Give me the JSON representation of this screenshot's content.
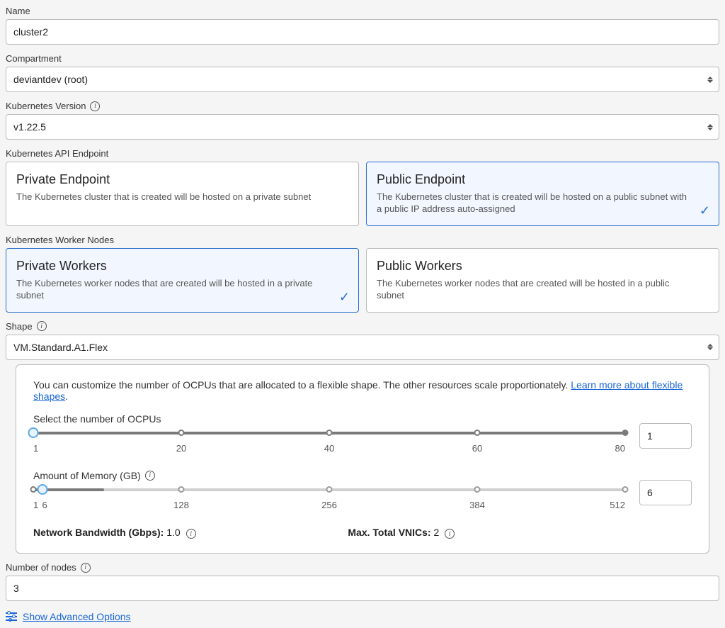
{
  "name": {
    "label": "Name",
    "value": "cluster2"
  },
  "compartment": {
    "label": "Compartment",
    "value": "deviantdev (root)"
  },
  "k8s_version": {
    "label": "Kubernetes Version",
    "value": "v1.22.5"
  },
  "api_endpoint": {
    "label": "Kubernetes API Endpoint",
    "private": {
      "title": "Private Endpoint",
      "desc": "The Kubernetes cluster that is created will be hosted on a private subnet"
    },
    "public": {
      "title": "Public Endpoint",
      "desc": "The Kubernetes cluster that is created will be hosted on a public subnet with a public IP address auto-assigned"
    },
    "selected": "public"
  },
  "worker_nodes": {
    "label": "Kubernetes Worker Nodes",
    "private": {
      "title": "Private Workers",
      "desc": "The Kubernetes worker nodes that are created will be hosted in a private subnet"
    },
    "public": {
      "title": "Public Workers",
      "desc": "The Kubernetes worker nodes that are created will be hosted in a public subnet"
    },
    "selected": "private"
  },
  "shape": {
    "label": "Shape",
    "value": "VM.Standard.A1.Flex",
    "intro_text": "You can customize the number of OCPUs that are allocated to a flexible shape. The other resources scale proportionately. ",
    "intro_link": "Learn more about flexible shapes",
    "ocpu": {
      "label": "Select the number of OCPUs",
      "min": 1,
      "max": 80,
      "value": 1,
      "ticks": [
        1,
        20,
        40,
        60,
        80
      ]
    },
    "memory": {
      "label": "Amount of Memory (GB)",
      "min": 1,
      "max": 512,
      "value": 6,
      "base_tick": 6,
      "ticks": [
        1,
        128,
        256,
        384,
        512
      ]
    },
    "bandwidth": {
      "label": "Network Bandwidth (Gbps):",
      "value": "1.0"
    },
    "vnics": {
      "label": "Max. Total VNICs:",
      "value": "2"
    }
  },
  "nodes": {
    "label": "Number of nodes",
    "value": "3"
  },
  "advanced_link": "Show Advanced Options"
}
